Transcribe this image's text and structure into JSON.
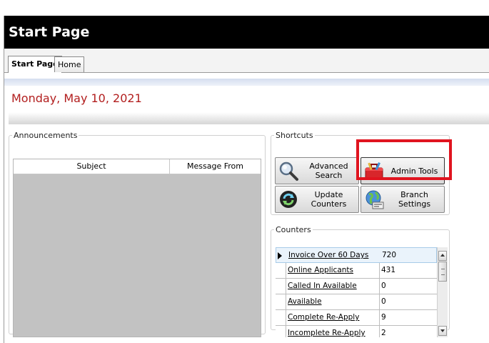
{
  "page_title": "Start Page",
  "tabs": [
    {
      "label": "Start Page",
      "active": true
    },
    {
      "label": "Home",
      "active": false
    }
  ],
  "date_text": "Monday, May 10, 2021",
  "announcements": {
    "legend": "Announcements",
    "columns": [
      "Subject",
      "Message From"
    ]
  },
  "shortcuts": {
    "legend": "Shortcuts",
    "buttons": [
      {
        "label": "Advanced Search",
        "icon": "magnifier-icon"
      },
      {
        "label": "Admin Tools",
        "icon": "toolbox-icon"
      },
      {
        "label": "Update Counters",
        "icon": "refresh-icon"
      },
      {
        "label": "Branch Settings",
        "icon": "globe-icon"
      }
    ]
  },
  "counters": {
    "legend": "Counters",
    "rows": [
      {
        "name": "Invoice Over 60 Days",
        "value": "720"
      },
      {
        "name": "Online Applicants",
        "value": "431"
      },
      {
        "name": "Called In Available",
        "value": "0"
      },
      {
        "name": "Available",
        "value": "0"
      },
      {
        "name": "Complete Re-Apply",
        "value": "9"
      },
      {
        "name": "Incomplete Re-Apply",
        "value": "2"
      }
    ]
  },
  "colors": {
    "date_red": "#b21e1e",
    "highlight_red": "#e0141f",
    "title_bg": "#000000"
  }
}
